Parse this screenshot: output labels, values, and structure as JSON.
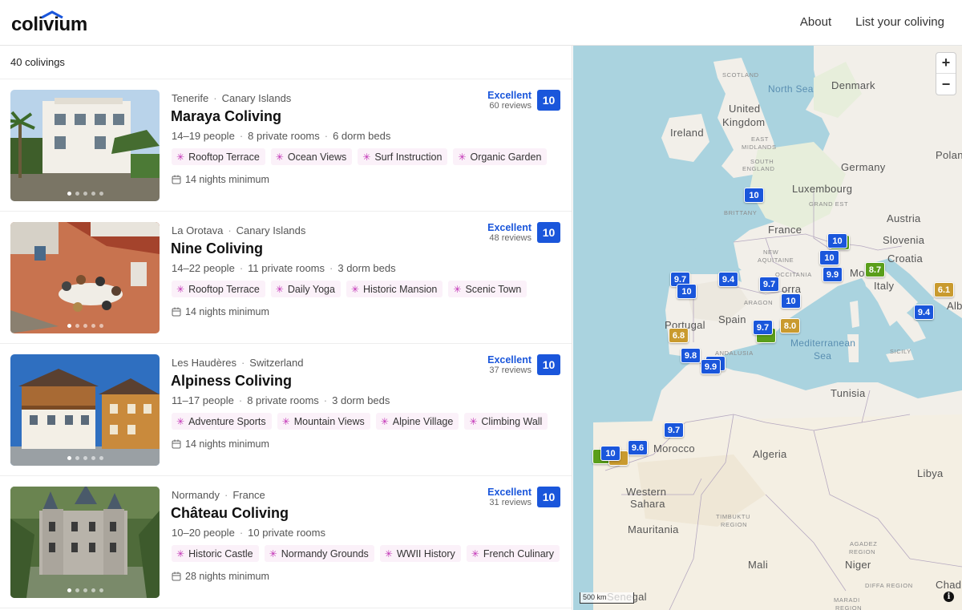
{
  "app": {
    "logo": "colivium"
  },
  "nav": [
    {
      "label": "About"
    },
    {
      "label": "List your coliving"
    }
  ],
  "list": {
    "count_label": "40 colivings"
  },
  "listings": [
    {
      "location": "Tenerife",
      "region": "Canary Islands",
      "name": "Maraya Coliving",
      "people": "14–19 people",
      "rooms": "8 private rooms",
      "dorms": "6 dorm beds",
      "tags": [
        "Rooftop Terrace",
        "Ocean Views",
        "Surf Instruction",
        "Organic Garden"
      ],
      "minimum": "14 nights minimum",
      "rating_label": "Excellent",
      "reviews": "60 reviews",
      "score": "10"
    },
    {
      "location": "La Orotava",
      "region": "Canary Islands",
      "name": "Nine Coliving",
      "people": "14–22 people",
      "rooms": "11 private rooms",
      "dorms": "3 dorm beds",
      "tags": [
        "Rooftop Terrace",
        "Daily Yoga",
        "Historic Mansion",
        "Scenic Town"
      ],
      "minimum": "14 nights minimum",
      "rating_label": "Excellent",
      "reviews": "48 reviews",
      "score": "10"
    },
    {
      "location": "Les Haudères",
      "region": "Switzerland",
      "name": "Alpiness Coliving",
      "people": "11–17 people",
      "rooms": "8 private rooms",
      "dorms": "3 dorm beds",
      "tags": [
        "Adventure Sports",
        "Mountain Views",
        "Alpine Village",
        "Climbing Wall"
      ],
      "minimum": "14 nights minimum",
      "rating_label": "Excellent",
      "reviews": "37 reviews",
      "score": "10"
    },
    {
      "location": "Normandy",
      "region": "France",
      "name": "Château Coliving",
      "people": "10–20 people",
      "rooms": "10 private rooms",
      "dorms": "",
      "tags": [
        "Historic Castle",
        "Normandy Grounds",
        "WWII History",
        "French Culinary"
      ],
      "minimum": "28 nights minimum",
      "rating_label": "Excellent",
      "reviews": "31 reviews",
      "score": "10"
    }
  ],
  "map": {
    "zoom_in": "+",
    "zoom_out": "−",
    "scale": "500 km",
    "info": "i",
    "labels": {
      "north_sea": "North Sea",
      "denmark": "Denmark",
      "scotland": "SCOTLAND",
      "united": "United",
      "kingdom": "Kingdom",
      "ireland": "Ireland",
      "east": "EAST",
      "midlands": "MIDLANDS",
      "south": "SOUTH",
      "england": "ENGLAND",
      "poland": "Polan",
      "germany": "Germany",
      "luxembourg": "Luxembourg",
      "grand_est": "GRAND EST",
      "brittany": "BRITTANY",
      "france": "France",
      "austria": "Austria",
      "slovenia": "Slovenia",
      "croatia": "Croatia",
      "nouvelle": "NEW",
      "aquitaine": "AQUITAINE",
      "occitania": "OCCITANIA",
      "italy": "Italy",
      "monaco": "Mo",
      "andorra": "orra",
      "aragon": "ARAGON",
      "portugal": "Portugal",
      "spain": "Spain",
      "albania": "Alba",
      "mediterranean": "Mediterranean",
      "sea": "Sea",
      "andalusia": "ANDALUSIA",
      "sicily": "SICILY",
      "tunisia": "Tunisia",
      "morocco": "Morocco",
      "algeria": "Algeria",
      "libya": "Libya",
      "western": "Western",
      "sahara": "Sahara",
      "mauritania": "Mauritania",
      "timbuktu": "TIMBUKTU",
      "region": "REGION",
      "agadez": "AGADEZ",
      "mali": "Mali",
      "niger": "Niger",
      "diffa": "DIFFA REGION",
      "maradi": "MARADI",
      "chad": "Chad",
      "senegal": "Senegal",
      "gibraltar": "tar"
    },
    "markers": [
      "10",
      "10",
      "10",
      "10",
      "9.9",
      "8.7",
      "9.7",
      "10",
      "9.4",
      "9.7",
      "10",
      "6.1",
      "9.4",
      "6.8",
      "9.7",
      "8.0",
      "8.9",
      "9.8",
      "10",
      "9.9",
      "9.7",
      "9.6",
      "10",
      "10"
    ],
    "colors": {
      "blue": "#1a56db",
      "green": "#5a9e1a",
      "amber": "#c99a2e"
    }
  }
}
